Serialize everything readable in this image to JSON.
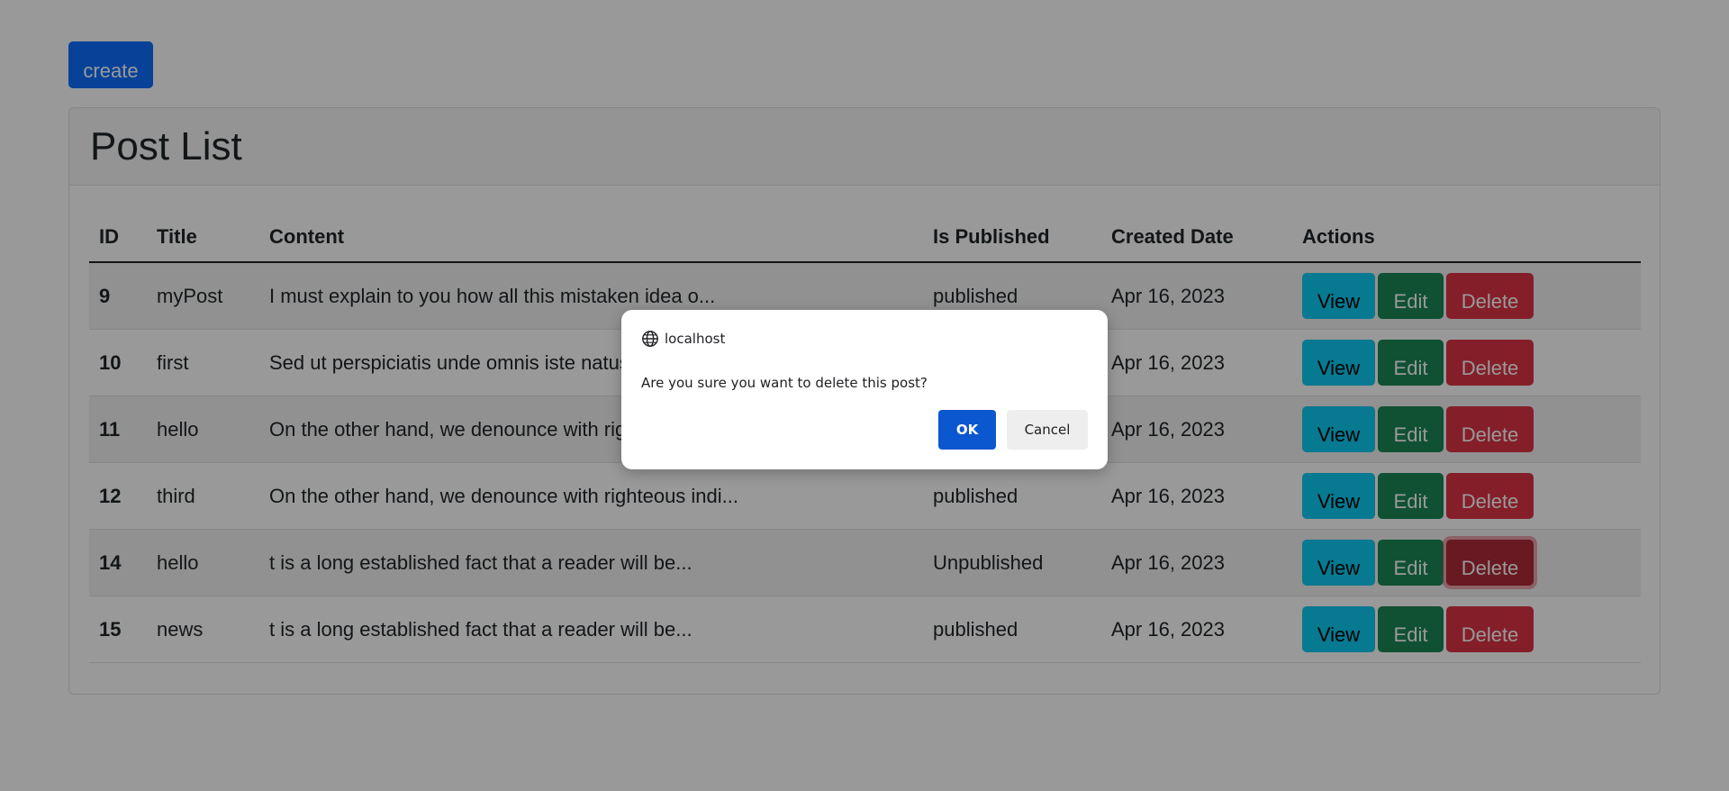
{
  "toolbar": {
    "create_label": "create"
  },
  "card": {
    "title": "Post List"
  },
  "table": {
    "headers": [
      "ID",
      "Title",
      "Content",
      "Is Published",
      "Created Date",
      "Actions"
    ],
    "rows": [
      {
        "id": "9",
        "title": "myPost",
        "content": "I must explain to you how all this mistaken idea o...",
        "published": "published",
        "created": "Apr 16, 2023"
      },
      {
        "id": "10",
        "title": "first",
        "content": "Sed ut perspiciatis unde omnis iste natus",
        "published": "",
        "created": "Apr 16, 2023"
      },
      {
        "id": "11",
        "title": "hello",
        "content": "On the other hand, we denounce with rig",
        "published": "",
        "created": "Apr 16, 2023"
      },
      {
        "id": "12",
        "title": "third",
        "content": "On the other hand, we denounce with righteous indi...",
        "published": "published",
        "created": "Apr 16, 2023"
      },
      {
        "id": "14",
        "title": "hello",
        "content": "t is a long established fact that a reader will be...",
        "published": "Unpublished",
        "created": "Apr 16, 2023"
      },
      {
        "id": "15",
        "title": "news",
        "content": "t is a long established fact that a reader will be...",
        "published": "published",
        "created": "Apr 16, 2023"
      }
    ],
    "actions": {
      "view": "View",
      "edit": "Edit",
      "delete": "Delete"
    }
  },
  "dialog": {
    "origin": "localhost",
    "origin_icon": "globe-icon",
    "message": "Are you sure you want to delete this post?",
    "ok_label": "OK",
    "cancel_label": "Cancel"
  },
  "colors": {
    "primary": "#0d6efd",
    "info": "#0dcaf0",
    "success": "#198754",
    "danger": "#dc3545",
    "dialog_ok": "#0b57d0"
  }
}
